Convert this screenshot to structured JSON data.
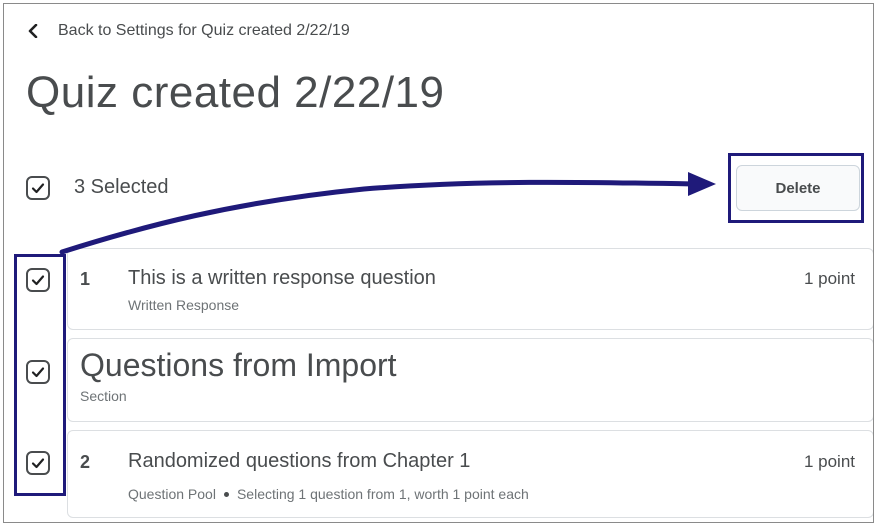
{
  "back_link": {
    "label": "Back to Settings for Quiz created 2/22/19"
  },
  "page_title": "Quiz created 2/22/19",
  "selection": {
    "count_label": "3 Selected",
    "delete_label": "Delete"
  },
  "items": [
    {
      "type": "question",
      "number": "1",
      "title": "This is a written response question",
      "subtitle": "Written Response",
      "points": "1 point"
    },
    {
      "type": "section",
      "title": "Questions from Import",
      "subtitle": "Section"
    },
    {
      "type": "question",
      "number": "2",
      "title": "Randomized questions from Chapter 1",
      "subtitle_type": "Question Pool",
      "subtitle_detail": "Selecting 1 question from 1, worth 1 point each",
      "points": "1 point"
    }
  ],
  "colors": {
    "annotation": "#1f1a7a",
    "text": "#494c4e",
    "card_border": "#dcdfe2"
  }
}
